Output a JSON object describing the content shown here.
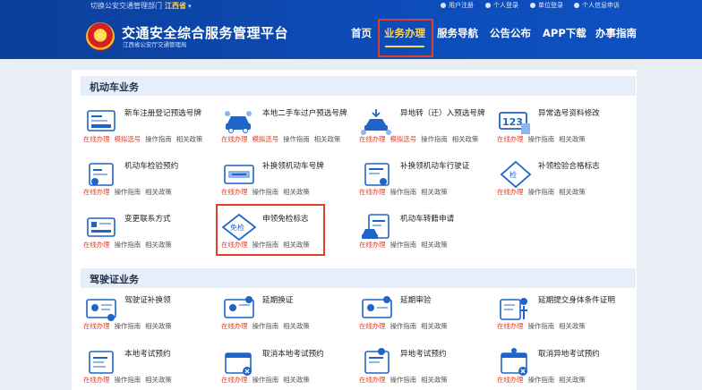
{
  "header": {
    "switch_text": "切换公安交通管理部门",
    "province": "江西省",
    "caret": "▾",
    "top_links": [
      "用户注册",
      "个人登录",
      "单位登录",
      "个人信息申诉"
    ],
    "title": "交通安全综合服务管理平台",
    "subtitle": "江西省公安厅交通管理局",
    "nav": [
      "首页",
      "业务办理",
      "服务导航",
      "公告公布",
      "APP下载",
      "办事指南"
    ],
    "active_nav": "业务办理"
  },
  "sections": [
    {
      "title": "机动车业务",
      "items": [
        {
          "name": "新车注册登记预选号牌",
          "icon": "new-car-plate",
          "links": [
            "在线办理",
            "模拟选号",
            "操作指南",
            "相关政策"
          ]
        },
        {
          "name": "本地二手车过户预选号牌",
          "icon": "used-car-transfer",
          "links": [
            "在线办理",
            "模拟选号",
            "操作指南",
            "相关政策"
          ]
        },
        {
          "name": "异地转（迁）入预选号牌",
          "icon": "transfer-in",
          "links": [
            "在线办理",
            "模拟选号",
            "操作指南",
            "相关政策"
          ]
        },
        {
          "name": "异常选号资料修改",
          "icon": "plate-123",
          "links": [
            "在线办理",
            "操作指南",
            "相关政策"
          ]
        },
        {
          "name": "机动车检验预约",
          "icon": "inspection-appointment",
          "links": [
            "在线办理",
            "操作指南",
            "相关政策"
          ]
        },
        {
          "name": "补换领机动车号牌",
          "icon": "replace-plate",
          "links": [
            "在线办理",
            "操作指南",
            "相关政策"
          ]
        },
        {
          "name": "补换领机动车行驶证",
          "icon": "replace-license",
          "links": [
            "在线办理",
            "操作指南",
            "相关政策"
          ]
        },
        {
          "name": "补领检验合格标志",
          "icon": "inspection-badge",
          "links": [
            "在线办理",
            "操作指南",
            "相关政策"
          ]
        },
        {
          "name": "变更联系方式",
          "icon": "contact-card",
          "links": [
            "在线办理",
            "操作指南",
            "相关政策"
          ]
        },
        {
          "name": "申领免检标志",
          "icon": "exempt-badge",
          "badge": "免检",
          "links": [
            "在线办理",
            "操作指南",
            "相关政策"
          ]
        },
        {
          "name": "机动车转籍申请",
          "icon": "transfer-registration",
          "links": [
            "在线办理",
            "操作指南",
            "相关政策"
          ]
        }
      ]
    },
    {
      "title": "驾驶证业务",
      "items": [
        {
          "name": "驾驶证补换领",
          "icon": "license-replace",
          "links": [
            "在线办理",
            "操作指南",
            "相关政策"
          ]
        },
        {
          "name": "延期换证",
          "icon": "license-renew",
          "links": [
            "在线办理",
            "操作指南",
            "相关政策"
          ]
        },
        {
          "name": "延期审验",
          "icon": "license-review",
          "links": [
            "在线办理",
            "操作指南",
            "相关政策"
          ]
        },
        {
          "name": "延期提交身体条件证明",
          "icon": "health-certificate",
          "links": [
            "在线办理",
            "操作指南",
            "相关政策"
          ]
        },
        {
          "name": "本地考试预约",
          "icon": "local-exam",
          "links": [
            "在线办理",
            "操作指南",
            "相关政策"
          ]
        },
        {
          "name": "取消本地考试预约",
          "icon": "cancel-local-exam",
          "links": [
            "在线办理",
            "操作指南",
            "相关政策"
          ]
        },
        {
          "name": "异地考试预约",
          "icon": "remote-exam",
          "links": [
            "在线办理",
            "操作指南",
            "相关政策"
          ]
        },
        {
          "name": "取消异地考试预约",
          "icon": "cancel-remote-exam",
          "links": [
            "在线办理",
            "操作指南",
            "相关政策"
          ]
        }
      ]
    }
  ],
  "colors": {
    "header": "#0d4cb8",
    "active": "#ffd45a",
    "link_red": "#e0402b",
    "icon_blue": "#1f64c8",
    "highlight": "#e0402b"
  }
}
